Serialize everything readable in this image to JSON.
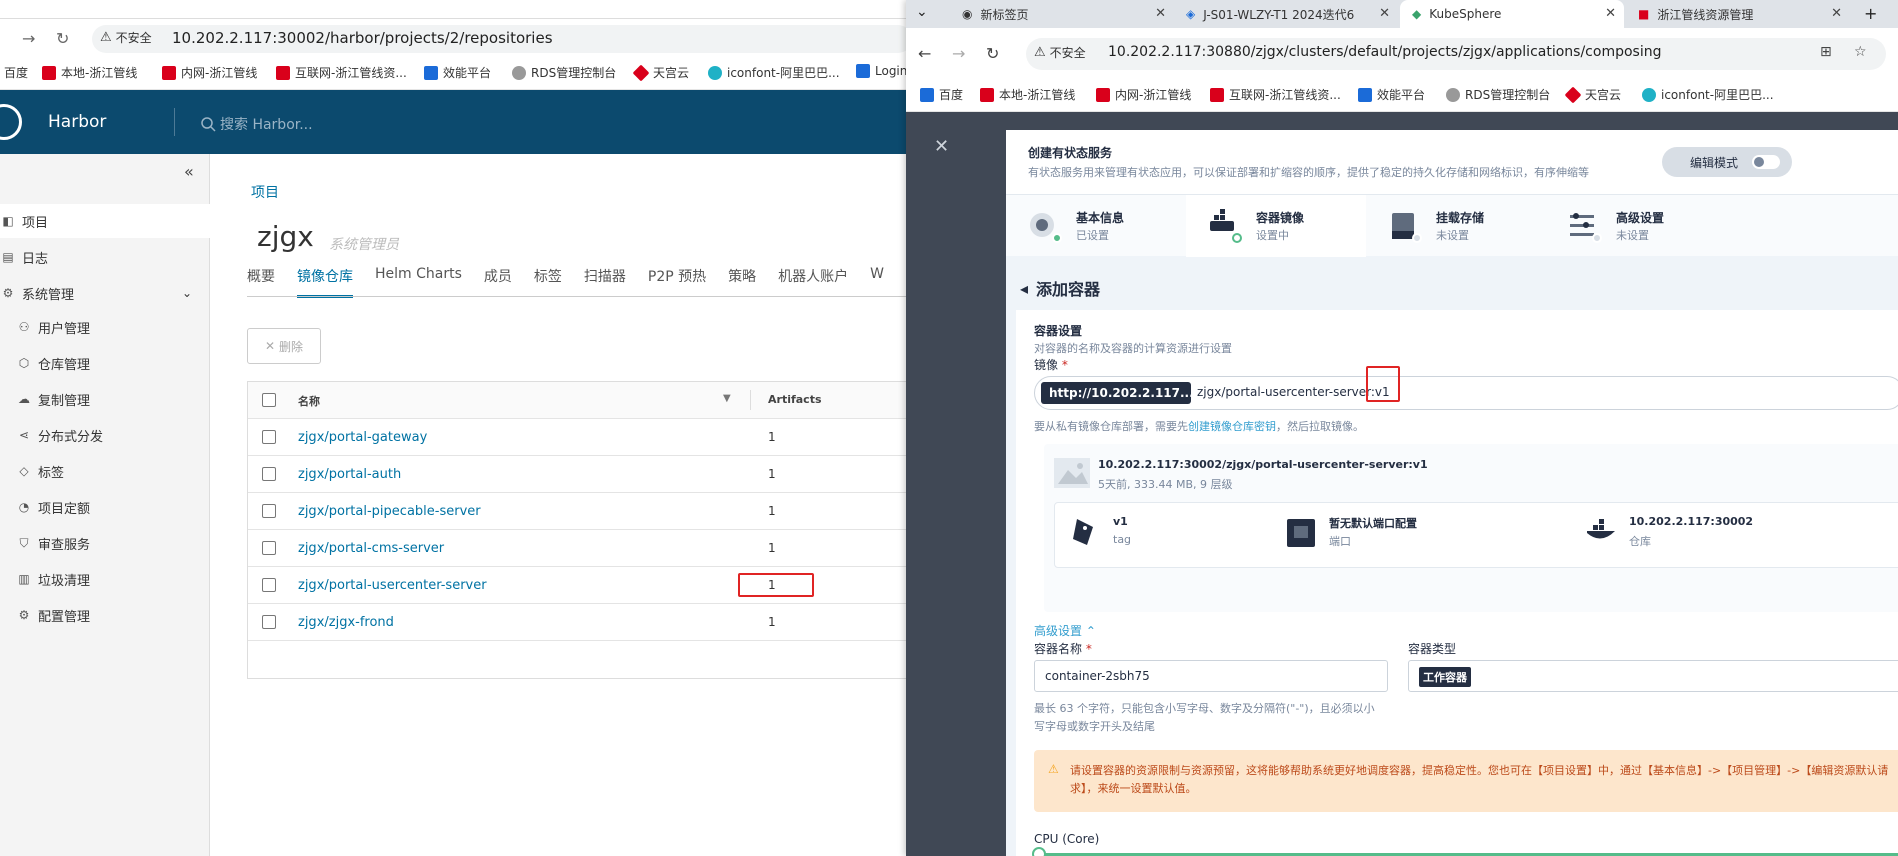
{
  "left": {
    "url_insecure": "不安全",
    "url": "10.202.2.117:30002/harbor/projects/2/repositories",
    "bookmarks": [
      "百度",
      "本地-浙江管线",
      "内网-浙江管线",
      "互联网-浙江管线资...",
      "效能平台",
      "RDS管理控制台",
      "天宫云",
      "iconfont-阿里巴巴...",
      "Login"
    ],
    "app_title": "Harbor",
    "search_placeholder": "搜索 Harbor...",
    "sidebar": [
      {
        "label": "项目",
        "icon": "project-icon"
      },
      {
        "label": "日志",
        "icon": "log-icon"
      },
      {
        "label": "系统管理",
        "icon": "admin-icon"
      },
      {
        "label": "用户管理",
        "icon": "users-icon"
      },
      {
        "label": "仓库管理",
        "icon": "box-icon"
      },
      {
        "label": "复制管理",
        "icon": "cloud-icon"
      },
      {
        "label": "分布式分发",
        "icon": "share-icon"
      },
      {
        "label": "标签",
        "icon": "tag-icon"
      },
      {
        "label": "项目定额",
        "icon": "quota-icon"
      },
      {
        "label": "审查服务",
        "icon": "shield-icon"
      },
      {
        "label": "垃圾清理",
        "icon": "trash-icon"
      },
      {
        "label": "配置管理",
        "icon": "gear-icon"
      }
    ],
    "breadcrumb": "项目",
    "project_name": "zjgx",
    "project_role": "系统管理员",
    "tabs": [
      "概要",
      "镜像仓库",
      "Helm Charts",
      "成员",
      "标签",
      "扫描器",
      "P2P 预热",
      "策略",
      "机器人账户",
      "W"
    ],
    "delete_label": "删除",
    "table": {
      "col_name": "名称",
      "col_artifacts": "Artifacts",
      "rows": [
        {
          "name": "zjgx/portal-gateway",
          "artifacts": "1"
        },
        {
          "name": "zjgx/portal-auth",
          "artifacts": "1"
        },
        {
          "name": "zjgx/portal-pipecable-server",
          "artifacts": "1"
        },
        {
          "name": "zjgx/portal-cms-server",
          "artifacts": "1"
        },
        {
          "name": "zjgx/portal-usercenter-server",
          "artifacts": "1"
        },
        {
          "name": "zjgx/zjgx-frond",
          "artifacts": "1"
        }
      ]
    }
  },
  "right": {
    "tabs": [
      "新标签页",
      "J-S01-WLZY-T1 2024迭代6",
      "KubeSphere",
      "浙江管线资源管理"
    ],
    "url_insecure": "不安全",
    "url": "10.202.2.117:30880/zjgx/clusters/default/projects/zjgx/applications/composing",
    "bookmarks": [
      "百度",
      "本地-浙江管线",
      "内网-浙江管线",
      "互联网-浙江管线资...",
      "效能平台",
      "RDS管理控制台",
      "天宫云",
      "iconfont-阿里巴巴..."
    ],
    "modal_title": "创建有状态服务",
    "modal_desc": "有状态服务用来管理有状态应用，可以保证部署和扩缩容的顺序，提供了稳定的持久化存储和网络标识，有序伸缩等",
    "edit_mode": "编辑模式",
    "steps": [
      {
        "title": "基本信息",
        "status": "已设置"
      },
      {
        "title": "容器镜像",
        "status": "设置中"
      },
      {
        "title": "挂载存储",
        "status": "未设置"
      },
      {
        "title": "高级设置",
        "status": "未设置"
      }
    ],
    "add_container": "添加容器",
    "container_settings": "容器设置",
    "container_settings_desc": "对容器的名称及容器的计算资源进行设置",
    "image_label": "镜像",
    "registry": "http://10.202.2.117...",
    "image_value": "zjgx/portal-usercenter-server:v1",
    "hint_pre": "要从私有镜像仓库部署，需要先",
    "hint_link": "创建镜像仓库密钥",
    "hint_post": "，然后拉取镜像。",
    "image_full": "10.202.2.117:30002/zjgx/portal-usercenter-server:v1",
    "image_meta": "5天前, 333.44 MB, 9 层级",
    "tag_value": "v1",
    "tag_label": "tag",
    "port_value": "暂无默认端口配置",
    "port_label": "端口",
    "repo_value": "10.202.2.117:30002",
    "repo_label": "仓库",
    "advanced": "高级设置",
    "container_name_label": "容器名称",
    "container_name": "container-2sbh75",
    "container_type_label": "容器类型",
    "container_type": "工作容器",
    "name_hint": "最长 63 个字符，只能包含小写字母、数字及分隔符(\"-\")，且必须以小写字母或数字开头及结尾",
    "warning": "请设置容器的资源限制与资源预留，这将能够帮助系统更好地调度容器，提高稳定性。您也可在【项目设置】中，通过【基本信息】->【项目管理】->【编辑资源默认请求】，来统一设置默认值。",
    "cpu_label": "CPU (Core)"
  }
}
